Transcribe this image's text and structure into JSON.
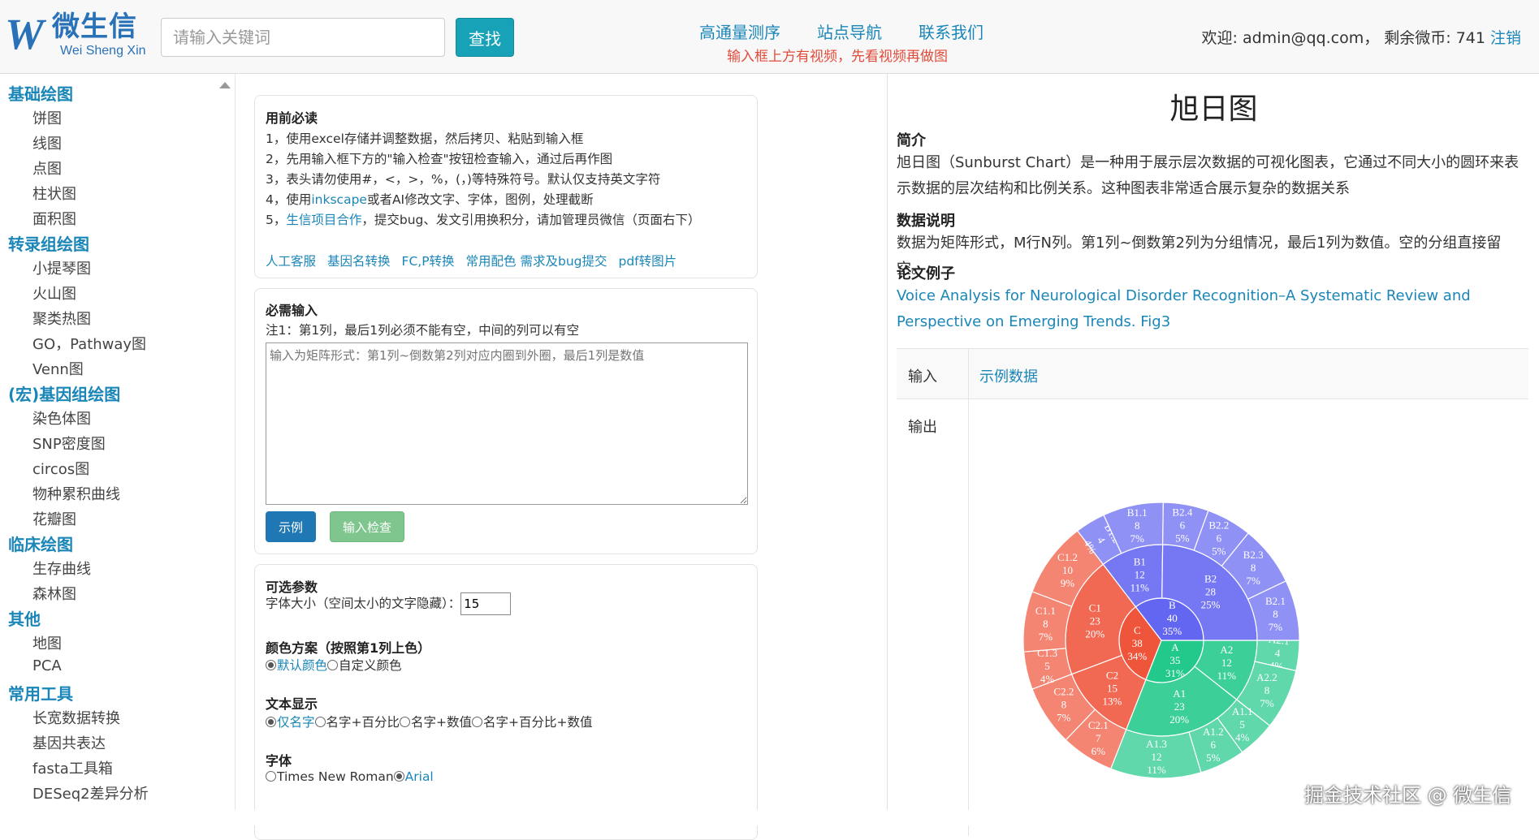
{
  "header": {
    "logo_letter": "W",
    "logo_cn": "微生信",
    "logo_en": "Wei Sheng Xin",
    "search_placeholder": "请输入关键词",
    "search_button": "查找",
    "nav": [
      "高通量测序",
      "站点导航",
      "联系我们"
    ],
    "notice": "输入框上方有视频，先看视频再做图",
    "welcome": "欢迎: admin@qq.com， 剩余微币: 741",
    "logout": "注销"
  },
  "sidebar": {
    "categories": [
      {
        "label": "基础绘图",
        "items": [
          "饼图",
          "线图",
          "点图",
          "柱状图",
          "面积图"
        ]
      },
      {
        "label": "转录组绘图",
        "items": [
          "小提琴图",
          "火山图",
          "聚类热图",
          "GO，Pathway图",
          "Venn图"
        ]
      },
      {
        "label": "(宏)基因组绘图",
        "items": [
          "染色体图",
          "SNP密度图",
          "circos图",
          "物种累积曲线",
          "花瓣图"
        ]
      },
      {
        "label": "临床绘图",
        "items": [
          "生存曲线",
          "森林图"
        ]
      },
      {
        "label": "其他",
        "items": [
          "地图",
          "PCA"
        ]
      },
      {
        "label": "常用工具",
        "items": [
          "长宽数据转换",
          "基因共表达",
          "fasta工具箱",
          "DESeq2差异分析"
        ]
      }
    ]
  },
  "readme": {
    "title": "用前必读",
    "lines": [
      "1，使用excel存储并调整数据，然后拷贝、粘贴到输入框",
      "2，先用输入框下方的\"输入检查\"按钮检查输入，通过后再作图",
      "3，表头请勿使用#，<，>，%，(，)等特殊符号。默认仅支持英文字符"
    ],
    "line4_a": "4，使用",
    "line4_link": "inkscape",
    "line4_b": "或者AI修改文字、字体，图例，处理截断",
    "line5_a": "5，",
    "line5_link": "生信项目合作",
    "line5_b": "，提交bug、发文引用换积分，请加管理员微信（页面右下）",
    "links": [
      "人工客服",
      "基因名转换",
      "FC,P转换",
      "常用配色 需求及bug提交",
      "pdf转图片"
    ]
  },
  "required": {
    "title": "必需输入",
    "note": "注1：第1列，最后1列必须不能有空，中间的列可以有空",
    "placeholder": "输入为矩阵形式：第1列~倒数第2列对应内圈到外圈，最后1列是数值",
    "example_button": "示例",
    "check_button": "输入检查"
  },
  "optional": {
    "title": "可选参数",
    "font_size_label": "字体大小（空间太小的文字隐藏）：",
    "font_size_value": "15",
    "color_title": "颜色方案（按照第1列上色）",
    "color_opt1": "默认颜色",
    "color_opt2": "自定义颜色",
    "text_title": "文本显示",
    "text_opt1": "仅名字",
    "text_opt2": "名字+百分比",
    "text_opt3": "名字+数值",
    "text_opt4": "名字+百分比+数值",
    "font_title": "字体",
    "font_opt1": "Times New Roman",
    "font_opt2": "Arial"
  },
  "info": {
    "title": "旭日图",
    "intro_h": "简介",
    "intro": "旭日图（Sunburst Chart）是一种用于展示层次数据的可视化图表，它通过不同大小的圆环来表示数据的层次结构和比例关系。这种图表非常适合展示复杂的数据关系",
    "data_h": "数据说明",
    "data": "数据为矩阵形式，M行N列。第1列~倒数第2列为分组情况，最后1列为数值。空的分组直接留空。",
    "paper_h": "论文例子",
    "paper": "Voice Analysis for Neurological Disorder Recognition–A Systematic Review and Perspective on Emerging Trends. Fig3",
    "input_label": "输入",
    "example_data": "示例数据",
    "output_label": "输出"
  },
  "watermark": "掘金技术社区 @ 微生信",
  "chart_data": {
    "type": "sunburst",
    "colors": {
      "A": "#22c98a",
      "B": "#6366f1",
      "C": "#ef553b"
    },
    "rings": [
      [
        {
          "name": "A",
          "value": 35,
          "pct": "31%"
        },
        {
          "name": "C",
          "value": 38,
          "pct": "34%"
        },
        {
          "name": "B",
          "value": 40,
          "pct": "35%"
        }
      ],
      [
        {
          "name": "A2",
          "parent": "A",
          "value": 12,
          "pct": "11%"
        },
        {
          "name": "A1",
          "parent": "A",
          "value": 23,
          "pct": "20%"
        },
        {
          "name": "C2",
          "parent": "C",
          "value": 15,
          "pct": "13%"
        },
        {
          "name": "C1",
          "parent": "C",
          "value": 23,
          "pct": "20%"
        },
        {
          "name": "B1",
          "parent": "B",
          "value": 12,
          "pct": "11%"
        },
        {
          "name": "B2",
          "parent": "B",
          "value": 28,
          "pct": "25%"
        }
      ],
      [
        {
          "name": "A2.1",
          "parent": "A2",
          "value": 4,
          "pct": "4%"
        },
        {
          "name": "A2.2",
          "parent": "A2",
          "value": 8,
          "pct": "7%"
        },
        {
          "name": "A1.1",
          "parent": "A1",
          "value": 5,
          "pct": "4%"
        },
        {
          "name": "A1.2",
          "parent": "A1",
          "value": 6,
          "pct": "5%"
        },
        {
          "name": "A1.3",
          "parent": "A1",
          "value": 12,
          "pct": "11%"
        },
        {
          "name": "C2.1",
          "parent": "C2",
          "value": 7,
          "pct": "6%"
        },
        {
          "name": "C2.2",
          "parent": "C2",
          "value": 8,
          "pct": "7%"
        },
        {
          "name": "C1.3",
          "parent": "C1",
          "value": 5,
          "pct": "4%"
        },
        {
          "name": "C1.1",
          "parent": "C1",
          "value": 8,
          "pct": "7%"
        },
        {
          "name": "C1.2",
          "parent": "C1",
          "value": 10,
          "pct": "9%"
        },
        {
          "name": "B1.2",
          "parent": "B1",
          "value": 4,
          "pct": "4%"
        },
        {
          "name": "B1.1",
          "parent": "B1",
          "value": 8,
          "pct": "7%"
        },
        {
          "name": "B2.4",
          "parent": "B2",
          "value": 6,
          "pct": "5%"
        },
        {
          "name": "B2.2",
          "parent": "B2",
          "value": 6,
          "pct": "5%"
        },
        {
          "name": "B2.3",
          "parent": "B2",
          "value": 8,
          "pct": "7%"
        },
        {
          "name": "B2.1",
          "parent": "B2",
          "value": 8,
          "pct": "7%"
        }
      ]
    ]
  }
}
